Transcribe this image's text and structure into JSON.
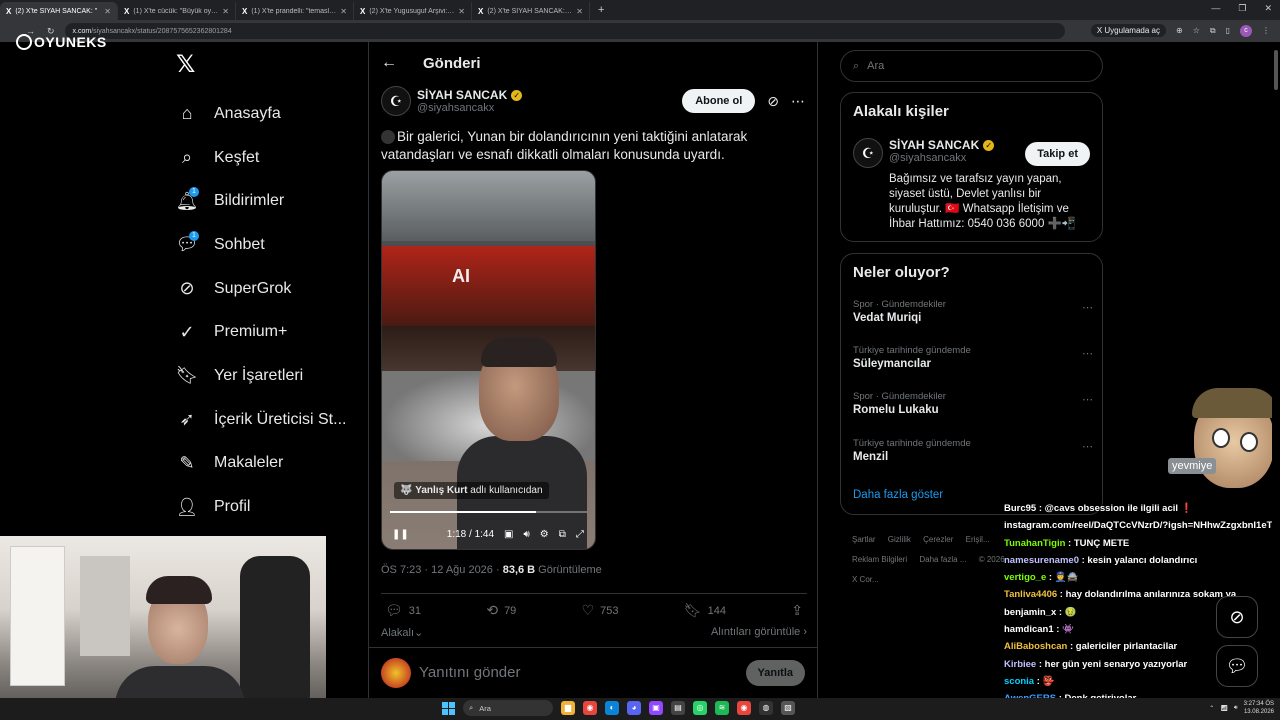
{
  "browser": {
    "tabs": [
      {
        "label": "(2) X'te SİYAH SANCAK: \"",
        "active": true
      },
      {
        "label": "(1) X'te cücük: \"Büyük oyunu gi",
        "active": false
      },
      {
        "label": "(1) X'te prandelli: \"temaslar htt",
        "active": false
      },
      {
        "label": "(2) X'te Yugusuguf Arşivi: \"özgü",
        "active": false
      },
      {
        "label": "(2) X'te SİYAH SANCAK: \"🔵 Ne",
        "active": false
      }
    ],
    "url_host": "x.com",
    "url_path": "/siyahsancakx/status/2087575652362801284",
    "app_button": "Uygulamada aç"
  },
  "overlay_logo": "OYUNEKS",
  "nav": {
    "items": [
      {
        "label": "Anasayfa",
        "icon": "home-icon"
      },
      {
        "label": "Keşfet",
        "icon": "search-icon"
      },
      {
        "label": "Bildirimler",
        "icon": "bell-icon",
        "badge": "1"
      },
      {
        "label": "Sohbet",
        "icon": "chat-icon",
        "badge": "1"
      },
      {
        "label": "SuperGrok",
        "icon": "grok-icon"
      },
      {
        "label": "Premium+",
        "icon": "premium-icon"
      },
      {
        "label": "Yer İşaretleri",
        "icon": "bookmark-icon"
      },
      {
        "label": "İçerik Üreticisi St...",
        "icon": "rocket-icon"
      },
      {
        "label": "Makaleler",
        "icon": "article-icon"
      },
      {
        "label": "Profil",
        "icon": "profile-icon"
      }
    ]
  },
  "post": {
    "header": "Gönderi",
    "author_name": "SİYAH SANCAK",
    "author_handle": "@siyahsancakx",
    "subscribe_label": "Abone ol",
    "text": "Bir galerici, Yunan bir dolandırıcının yeni taktiğini anlatarak vatandaşları ve esnafı dikkatli olmaları konusunda uyardı.",
    "video": {
      "credit_name": "Yanlış Kurt",
      "credit_suffix": "adlı kullanıcıdan",
      "time": "1:18 / 1:44",
      "progress": 0.74,
      "sign": "AI"
    },
    "meta_time": "ÖS 7:23 · 12 Ağu 2026 · ",
    "meta_views": "83,6 B",
    "meta_views_label": " Görüntüleme",
    "replies": "31",
    "reposts": "79",
    "likes": "753",
    "bookmarks": "144",
    "related_label": "Alakalı",
    "quotes_label": "Alıntıları görüntüle",
    "reply_placeholder": "Yanıtını gönder",
    "reply_button": "Yanıtla"
  },
  "right": {
    "search_placeholder": "Ara",
    "related_title": "Alakalı kişiler",
    "related_person": {
      "name": "SİYAH SANCAK",
      "handle": "@siyahsancakx",
      "follow_label": "Takip et",
      "bio": "Bağımsız ve tarafsız yayın yapan, siyaset üstü, Devlet yanlısı bir kuruluştur. 🇹🇷 Whatsapp İletişim ve İhbar Hattımız: 0540 036 6000 ➕📲"
    },
    "trends_title": "Neler oluyor?",
    "trends": [
      {
        "category": "Spor · Gündemdekiler",
        "name": "Vedat Muriqi"
      },
      {
        "category": "Türkiye tarihinde gündemde",
        "name": "Süleymancılar"
      },
      {
        "category": "Spor · Gündemdekiler",
        "name": "Romelu Lukaku"
      },
      {
        "category": "Türkiye tarihinde gündemde",
        "name": "Menzil"
      }
    ],
    "show_more": "Daha fazla göster",
    "footer": [
      "Şartlar",
      "Gizlilik",
      "Çerezler",
      "Erişil...",
      "Reklam Bilgileri",
      "Daha fazla ...",
      "© 2026 X Cor..."
    ]
  },
  "stream": {
    "mascot_label": "yevmiye",
    "chat": [
      {
        "user": "Burc95",
        "msg": ": @cavs obsession ile ilgili acil ❗",
        "color": "#ffffff"
      },
      {
        "user": "",
        "msg": "instagram.com/reel/DaQTCcVNzrD/?igsh=NHhwZzgxbnI1eTJ1",
        "color": "#ffffff"
      },
      {
        "user": "TunahanTigin",
        "msg": ": TUNÇ METE",
        "color": "#7cfc00"
      },
      {
        "user": "namesurename0",
        "msg": ": kesin yalancı dolandırıcı",
        "color": "#c0c0ff"
      },
      {
        "user": "vertigo_e",
        "msg": ": 👮🚔",
        "color": "#7cfc00"
      },
      {
        "user": "Tanliva4406",
        "msg": ": hay dolandırılma anılarınıza sokam ya",
        "color": "#f0c040"
      },
      {
        "user": "benjamin_x",
        "msg": ": 🤢",
        "color": "#ffffff"
      },
      {
        "user": "hamdican1",
        "msg": ": 👾",
        "color": "#ffffff"
      },
      {
        "user": "AliBaboshcan",
        "msg": ": galericiler pirlantacilar",
        "color": "#f0c040"
      },
      {
        "user": "Kirbiee",
        "msg": ": her gün yeni senaryo yazıyorlar",
        "color": "#c0c0ff"
      },
      {
        "user": "sconia",
        "msg": ": 👺",
        "color": "#00d0ff"
      },
      {
        "user": "AwenGERS",
        "msg": ": Denk getiriyolar",
        "color": "#40a0ff"
      }
    ]
  },
  "taskbar": {
    "search": "Ara",
    "time": "3:27:34 ÖS",
    "date": "13.08.2026"
  }
}
